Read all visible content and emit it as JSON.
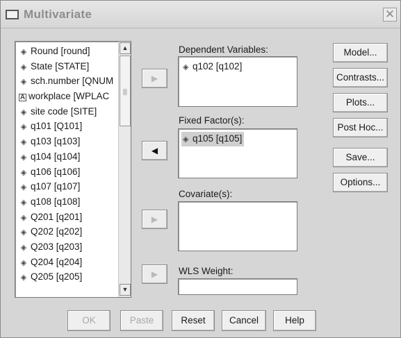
{
  "window": {
    "title": "Multivariate",
    "close_glyph": "✕"
  },
  "variables": [
    {
      "icon": "scale-icon",
      "label": "Round [round]"
    },
    {
      "icon": "scale-icon",
      "label": "State [STATE]"
    },
    {
      "icon": "scale-icon",
      "label": "sch.number [QNUM"
    },
    {
      "icon": "nominal-string-icon",
      "label": "workplace [WPLAC"
    },
    {
      "icon": "scale-icon",
      "label": "site code [SITE]"
    },
    {
      "icon": "scale-icon",
      "label": "q101 [Q101]"
    },
    {
      "icon": "scale-icon",
      "label": "q103 [q103]"
    },
    {
      "icon": "scale-icon",
      "label": "q104 [q104]"
    },
    {
      "icon": "scale-icon",
      "label": "q106 [q106]"
    },
    {
      "icon": "scale-icon",
      "label": "q107 [q107]"
    },
    {
      "icon": "scale-icon",
      "label": "q108 [q108]"
    },
    {
      "icon": "scale-icon",
      "label": "Q201 [q201]"
    },
    {
      "icon": "scale-icon",
      "label": "Q202 [q202]"
    },
    {
      "icon": "scale-icon",
      "label": "Q203 [q203]"
    },
    {
      "icon": "scale-icon",
      "label": "Q204 [q204]"
    },
    {
      "icon": "scale-icon",
      "label": "Q205 [q205]"
    }
  ],
  "sections": {
    "dependent": {
      "label": "Dependent Variables:",
      "items": [
        "q102 [q102]"
      ]
    },
    "fixed": {
      "label": "Fixed Factor(s):",
      "items": [
        "q105 [q105]"
      ]
    },
    "covariate": {
      "label": "Covariate(s):",
      "items": []
    },
    "wls": {
      "label": "WLS Weight:",
      "items": []
    }
  },
  "arrows": {
    "dependent": "▶",
    "fixed": "◀",
    "covariate": "▶",
    "wls": "▶"
  },
  "side_buttons": {
    "model": "Model...",
    "contrasts": "Contrasts...",
    "plots": "Plots...",
    "posthoc": "Post Hoc...",
    "save": "Save...",
    "options": "Options..."
  },
  "bottom_buttons": {
    "ok": "OK",
    "paste": "Paste",
    "reset": "Reset",
    "cancel": "Cancel",
    "help": "Help"
  },
  "scroll": {
    "up": "▲",
    "down": "▼"
  }
}
